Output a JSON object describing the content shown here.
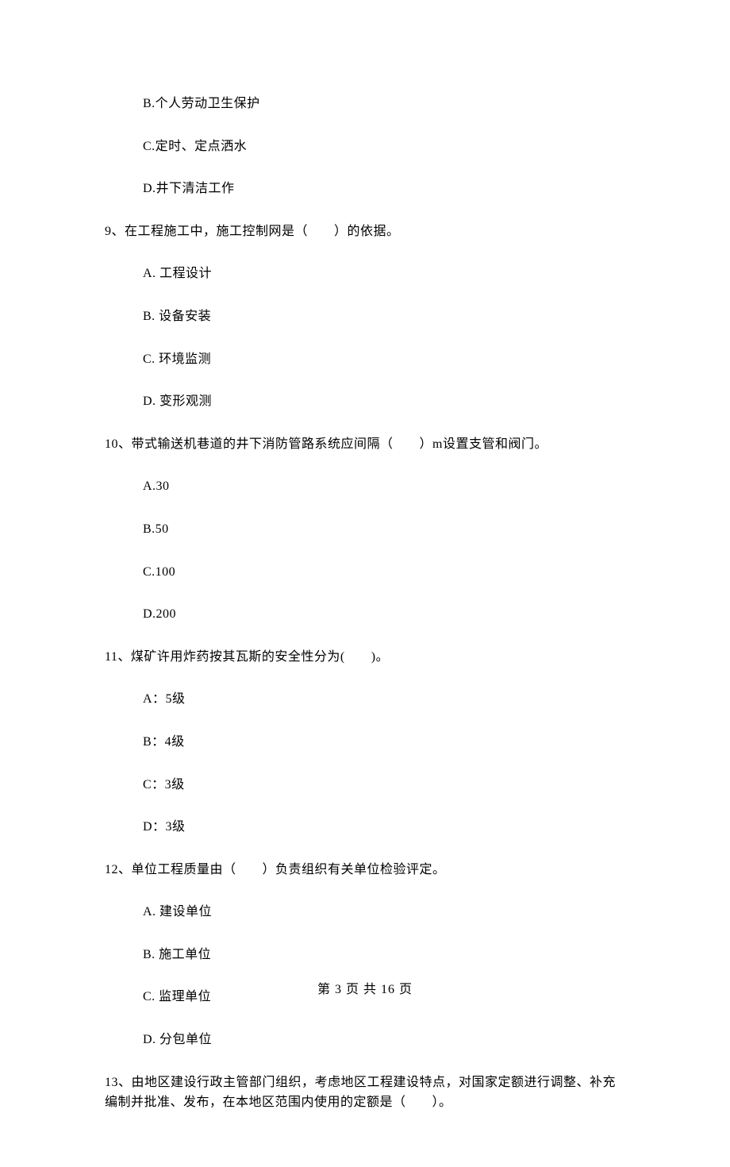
{
  "q8": {
    "options": {
      "B": "B.个人劳动卫生保护",
      "C": "C.定时、定点洒水",
      "D": "D.井下清洁工作"
    }
  },
  "q9": {
    "text": "9、在工程施工中，施工控制网是（　　）的依据。",
    "options": {
      "A": "A.  工程设计",
      "B": "B.  设备安装",
      "C": "C.  环境监测",
      "D": "D.  变形观测"
    }
  },
  "q10": {
    "text": "10、带式输送机巷道的井下消防管路系统应间隔（　　）m设置支管和阀门。",
    "options": {
      "A": "A.30",
      "B": "B.50",
      "C": "C.100",
      "D": "D.200"
    }
  },
  "q11": {
    "text": "11、煤矿许用炸药按其瓦斯的安全性分为(　　)。",
    "options": {
      "A": "A：5级",
      "B": "B：4级",
      "C": "C：3级",
      "D": "D：3级"
    }
  },
  "q12": {
    "text": "12、单位工程质量由（　　）负责组织有关单位检验评定。",
    "options": {
      "A": "A.  建设单位",
      "B": "B.  施工单位",
      "C": "C.  监理单位",
      "D": "D.  分包单位"
    }
  },
  "q13": {
    "text": "13、由地区建设行政主管部门组织，考虑地区工程建设特点，对国家定额进行调整、补充编制并批准、发布，在本地区范围内使用的定额是（　　）。"
  },
  "footer": "第 3 页 共 16 页"
}
